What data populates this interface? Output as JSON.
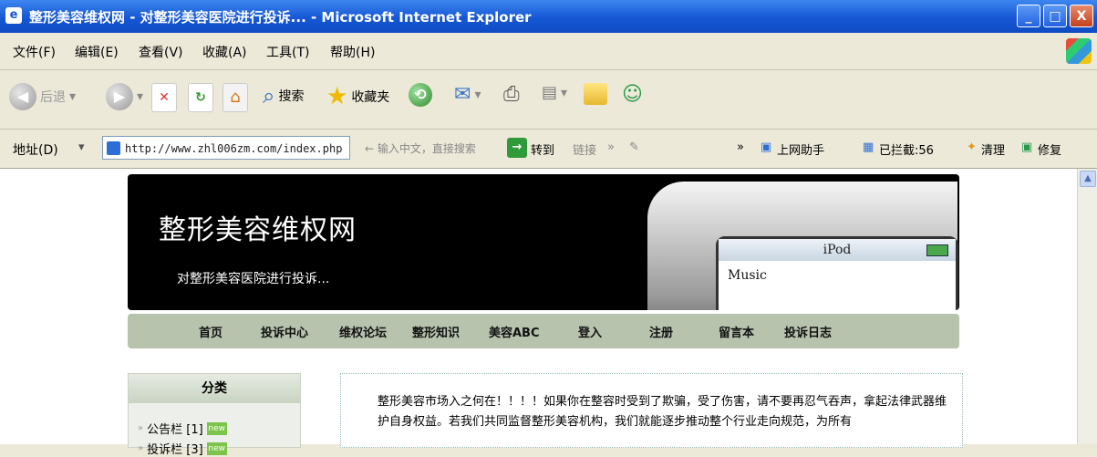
{
  "window": {
    "title": "整形美容维权网 - 对整形美容医院进行投诉... - Microsoft Internet Explorer",
    "buttons": {
      "minimize": "_",
      "maximize": "□",
      "close": "X"
    }
  },
  "menu": {
    "items": [
      "文件(F)",
      "编辑(E)",
      "查看(V)",
      "收藏(A)",
      "工具(T)",
      "帮助(H)"
    ]
  },
  "toolbar": {
    "back": "后退",
    "search": "搜索",
    "favorites": "收藏夹"
  },
  "address_bar": {
    "label": "地址(D)",
    "url": "http://www.zhl006zm.com/index.php",
    "search_hint": "← 输入中文，直接搜索",
    "go_label": "转到",
    "links_label": "链接",
    "ext1": "上网助手",
    "ext2": "已拦截:56",
    "ext3": "清理",
    "ext4": "修复"
  },
  "page": {
    "site_title": "整形美容维权网",
    "tagline": "对整形美容医院进行投诉...",
    "ipod": {
      "brand": "iPod",
      "menu_item": "Music"
    },
    "nav": [
      "首页",
      "投诉中心",
      "维权论坛",
      "整形知识",
      "美容ABC",
      "登入",
      "注册",
      "留言本",
      "投诉日志"
    ],
    "sidebar": {
      "heading": "分类",
      "categories": [
        {
          "label": "公告栏 [1]",
          "tag": "new"
        },
        {
          "label": "投诉栏 [3]",
          "tag": "new"
        }
      ]
    },
    "content_text": "整形美容市场入之何在！！！！如果你在整容时受到了欺骗，受了伤害，请不要再忍气吞声，拿起法律武器维护自身权益。若我们共同监督整形美容机构，我们就能逐步推动整个行业走向规范，为所有"
  }
}
